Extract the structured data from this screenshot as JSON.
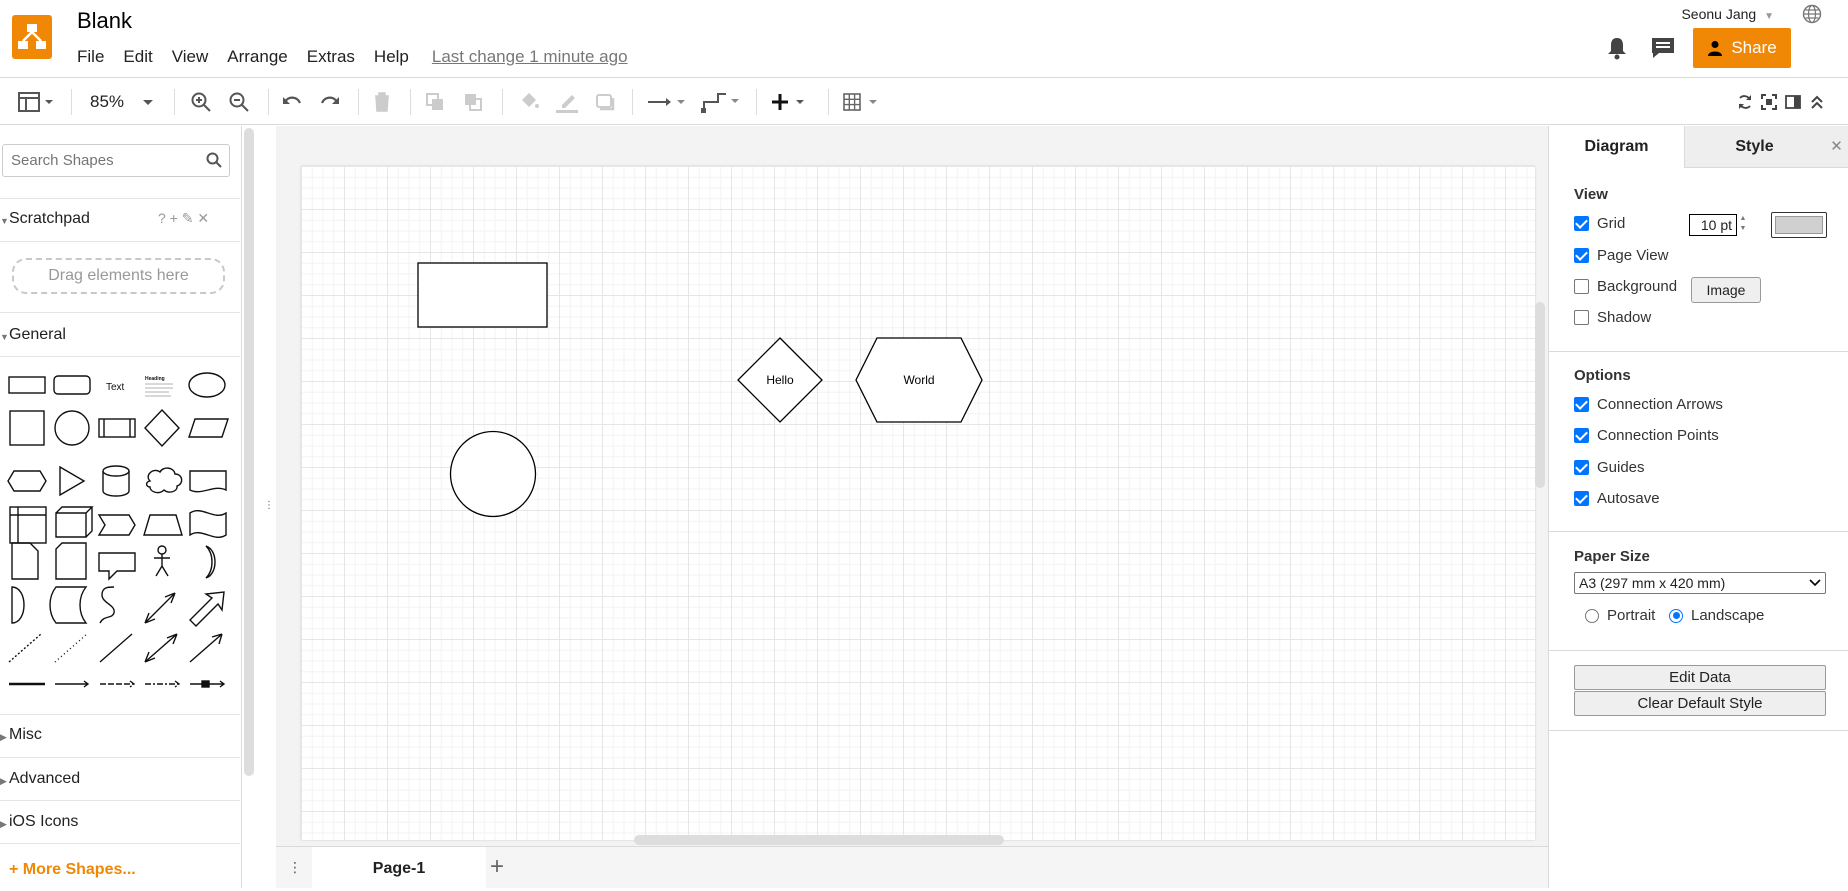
{
  "app": {
    "title": "Blank",
    "menu": [
      "File",
      "Edit",
      "View",
      "Arrange",
      "Extras",
      "Help"
    ],
    "last_change": "Last change 1 minute ago",
    "user": "Seonu Jang",
    "share_label": "Share",
    "accent_color": "#f08705"
  },
  "toolbar": {
    "zoom": "85%"
  },
  "sidebar": {
    "search_placeholder": "Search Shapes",
    "scratchpad_label": "Scratchpad",
    "scratchpad_actions": "? + ✎ ✕",
    "drag_hint": "Drag elements here",
    "general_label": "General",
    "text_shape_label": "Text",
    "heading_shape_label": "Heading",
    "sections": [
      "Misc",
      "Advanced",
      "iOS Icons"
    ],
    "more_shapes": "+ More Shapes..."
  },
  "canvas": {
    "shapes": [
      {
        "type": "rectangle",
        "label": ""
      },
      {
        "type": "circle",
        "label": ""
      },
      {
        "type": "diamond",
        "label": "Hello"
      },
      {
        "type": "hexagon",
        "label": "World"
      }
    ]
  },
  "pages": {
    "active": "Page-1"
  },
  "format_panel": {
    "tabs": [
      "Diagram",
      "Style"
    ],
    "view_title": "View",
    "grid_label": "Grid",
    "grid_size": "10 pt",
    "page_view_label": "Page View",
    "background_label": "Background",
    "image_button": "Image",
    "shadow_label": "Shadow",
    "options_title": "Options",
    "options": [
      "Connection Arrows",
      "Connection Points",
      "Guides",
      "Autosave"
    ],
    "paper_size_title": "Paper Size",
    "paper_size": "A3 (297 mm x 420 mm)",
    "portrait_label": "Portrait",
    "landscape_label": "Landscape",
    "edit_data": "Edit Data",
    "clear_default_style": "Clear Default Style"
  }
}
